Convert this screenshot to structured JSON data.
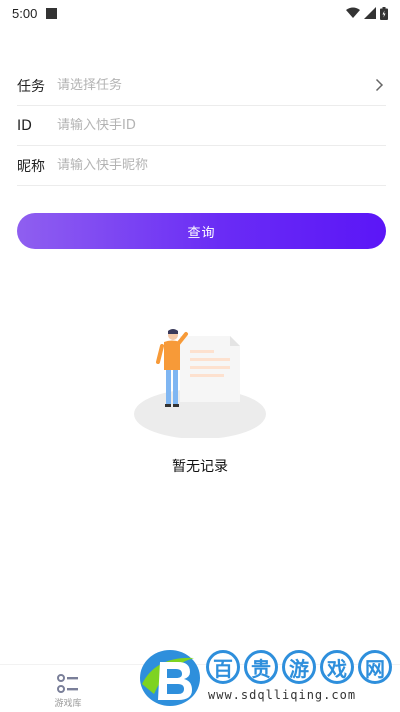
{
  "status_bar": {
    "time": "5:00",
    "icons": [
      "notification-square-icon",
      "wifi-icon",
      "signal-icon",
      "battery-icon"
    ]
  },
  "form": {
    "task_label": "任务",
    "task_placeholder": "请选择任务",
    "id_label": "ID",
    "id_placeholder": "请输入快手ID",
    "nickname_label": "昵称",
    "nickname_placeholder": "请输入快手昵称"
  },
  "query_button": {
    "label": "查询",
    "gradient_colors": [
      "#8f5ff0",
      "#5b16f7"
    ]
  },
  "empty_state": {
    "text": "暂无记录",
    "illustration": "person-with-document-illustration"
  },
  "bottom_nav": {
    "items": [
      {
        "label": "游戏库",
        "icon": "list-icon"
      }
    ]
  },
  "watermark": {
    "chars": [
      "百",
      "贵",
      "游",
      "戏",
      "网"
    ],
    "url": "www.sdqlliqing.com",
    "accent": "#2e8fdc"
  }
}
